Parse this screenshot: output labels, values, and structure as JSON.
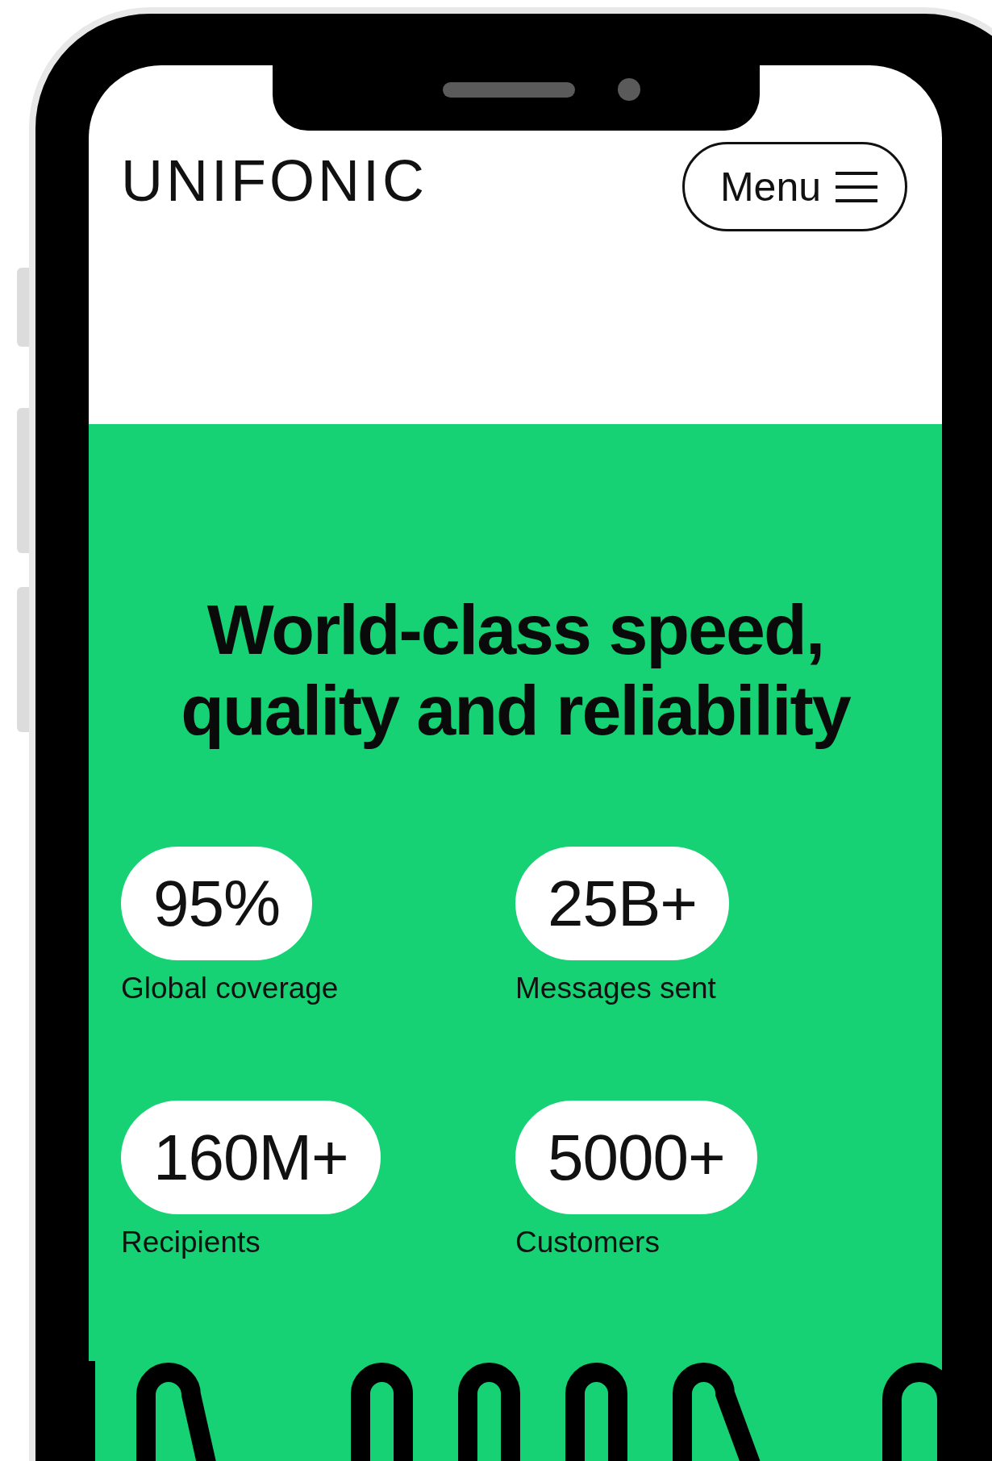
{
  "header": {
    "logo": "UNIFONIC",
    "menu_button": {
      "label": "Menu"
    }
  },
  "hero": {
    "heading": "World-class speed, quality and reliability"
  },
  "stats": [
    {
      "value": "95%",
      "label": "Global coverage"
    },
    {
      "value": "25B+",
      "label": "Messages sent"
    },
    {
      "value": "160M+",
      "label": "Recipients"
    },
    {
      "value": "5000+",
      "label": "Customers"
    }
  ]
}
